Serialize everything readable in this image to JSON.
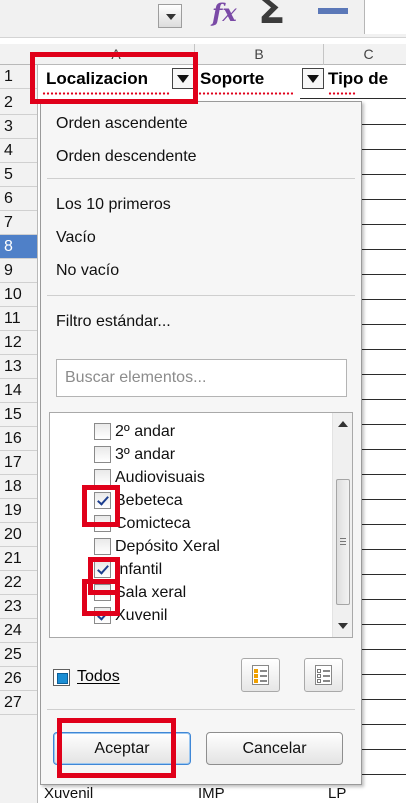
{
  "grid": {
    "columns": [
      "A",
      "B",
      "C"
    ],
    "rows": [
      "1",
      "2",
      "3",
      "4",
      "5",
      "6",
      "7",
      "8",
      "9",
      "10",
      "11",
      "12",
      "13",
      "14",
      "15",
      "16",
      "17",
      "18",
      "19",
      "20",
      "21",
      "22",
      "23",
      "24",
      "25",
      "26",
      "27"
    ],
    "header_cells": [
      "Localizacion",
      "Soporte",
      "Tipo de"
    ],
    "row27": [
      "Xuvenil",
      "IMP",
      "LP"
    ]
  },
  "toolbar": {
    "function_icon": "fx",
    "sum_icon": "Σ",
    "equals_icon": "="
  },
  "filter_popup": {
    "sort_ascending": "Orden ascendente",
    "sort_descending": "Orden descendente",
    "top10": "Los 10 primeros",
    "empty": "Vacío",
    "not_empty": "No vacío",
    "standard_filter": "Filtro estándar...",
    "search_placeholder": "Buscar elementos...",
    "items": [
      {
        "label": "2º andar",
        "checked": false
      },
      {
        "label": "3º andar",
        "checked": false
      },
      {
        "label": "Audiovisuais",
        "checked": false
      },
      {
        "label": "Bebeteca",
        "checked": true
      },
      {
        "label": "Comicteca",
        "checked": false
      },
      {
        "label": "Depósito Xeral",
        "checked": false
      },
      {
        "label": "Infantil",
        "checked": true
      },
      {
        "label": "Sala xeral",
        "checked": false
      },
      {
        "label": "Xuvenil",
        "checked": true
      }
    ],
    "all_label": "Todos",
    "select_all_icon": "select-all-icon",
    "select_none_icon": "select-none-icon",
    "ok_label": "Aceptar",
    "cancel_label": "Cancelar"
  },
  "colors": {
    "highlight": "#e0001a",
    "selected_row": "#4f80c8",
    "checkmark": "#1d3f8f"
  }
}
